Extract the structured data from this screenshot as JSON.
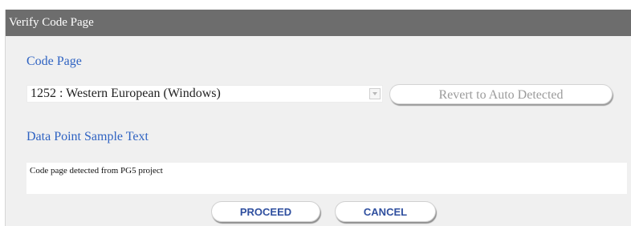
{
  "dialog": {
    "title": "Verify Code Page"
  },
  "code_page": {
    "label": "Code Page",
    "selected_value": "1252 : Western European (Windows)",
    "revert_button_label": "Revert to Auto Detected"
  },
  "sample": {
    "label": "Data Point Sample Text",
    "text": "Code page detected from PG5 project"
  },
  "actions": {
    "proceed_label": "PROCEED",
    "cancel_label": "CANCEL"
  },
  "colors": {
    "title_bar": "#6d6d6d",
    "label_blue": "#2f63c2",
    "button_text": "#2f4f9f"
  }
}
